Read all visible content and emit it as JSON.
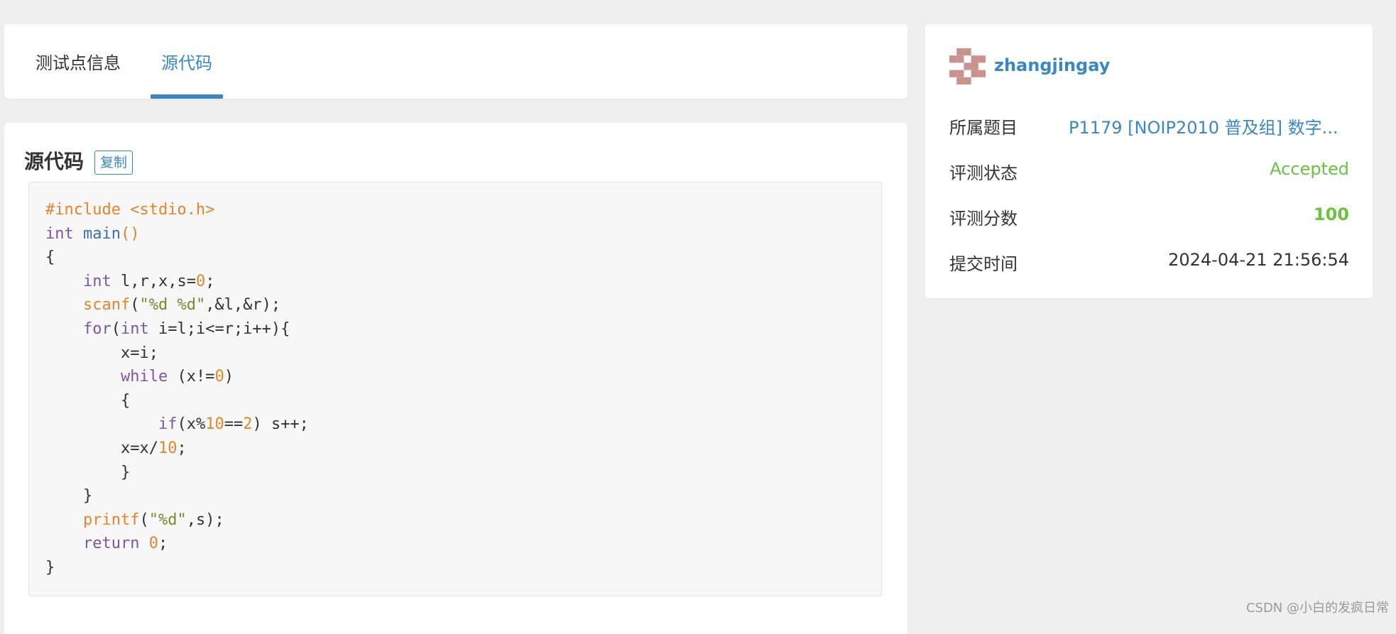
{
  "tabs": {
    "info_label": "测试点信息",
    "source_label": "源代码"
  },
  "source": {
    "title": "源代码",
    "copy_label": "复制",
    "code_lines": [
      [
        [
          "pre",
          "#include <stdio.h>"
        ]
      ],
      [
        [
          "kw",
          "int"
        ],
        [
          "plain",
          " "
        ],
        [
          "fn",
          "main"
        ],
        [
          "call",
          "()"
        ]
      ],
      [
        [
          "plain",
          "{"
        ]
      ],
      [
        [
          "plain",
          "    "
        ],
        [
          "kw",
          "int"
        ],
        [
          "plain",
          " l,r,x,s="
        ],
        [
          "num",
          "0"
        ],
        [
          "plain",
          ";"
        ]
      ],
      [
        [
          "plain",
          "    "
        ],
        [
          "call",
          "scanf"
        ],
        [
          "plain",
          "("
        ],
        [
          "str",
          "\"%d %d\""
        ],
        [
          "plain",
          ",&l,&r);"
        ]
      ],
      [
        [
          "plain",
          "    "
        ],
        [
          "kw",
          "for"
        ],
        [
          "plain",
          "("
        ],
        [
          "kw",
          "int"
        ],
        [
          "plain",
          " i=l;i<=r;i++){"
        ]
      ],
      [
        [
          "plain",
          "        x=i;"
        ]
      ],
      [
        [
          "plain",
          "        "
        ],
        [
          "kw",
          "while"
        ],
        [
          "plain",
          " (x!="
        ],
        [
          "num",
          "0"
        ],
        [
          "plain",
          ")"
        ]
      ],
      [
        [
          "plain",
          "        {"
        ]
      ],
      [
        [
          "plain",
          "            "
        ],
        [
          "kw",
          "if"
        ],
        [
          "plain",
          "(x%"
        ],
        [
          "num",
          "10"
        ],
        [
          "plain",
          "=="
        ],
        [
          "num",
          "2"
        ],
        [
          "plain",
          ") s++;"
        ]
      ],
      [
        [
          "plain",
          "        x=x/"
        ],
        [
          "num",
          "10"
        ],
        [
          "plain",
          ";"
        ]
      ],
      [
        [
          "plain",
          "        }"
        ]
      ],
      [
        [
          "plain",
          "    }"
        ]
      ],
      [
        [
          "plain",
          "    "
        ],
        [
          "call",
          "printf"
        ],
        [
          "plain",
          "("
        ],
        [
          "str",
          "\"%d\""
        ],
        [
          "plain",
          ",s);"
        ]
      ],
      [
        [
          "plain",
          "    "
        ],
        [
          "kw",
          "return"
        ],
        [
          "plain",
          " "
        ],
        [
          "num",
          "0"
        ],
        [
          "plain",
          ";"
        ]
      ],
      [
        [
          "plain",
          "}"
        ]
      ]
    ]
  },
  "user": {
    "name": "zhangjingay",
    "avatar_color": "#c9928a"
  },
  "info": {
    "problem_label": "所属题目",
    "problem_value": "P1179 [NOIP2010 普及组] 数字...",
    "status_label": "评测状态",
    "status_value": "Accepted",
    "score_label": "评测分数",
    "score_value": "100",
    "time_label": "提交时间",
    "time_value": "2024-04-21 21:56:54"
  },
  "watermark": "CSDN @小白的发疯日常"
}
